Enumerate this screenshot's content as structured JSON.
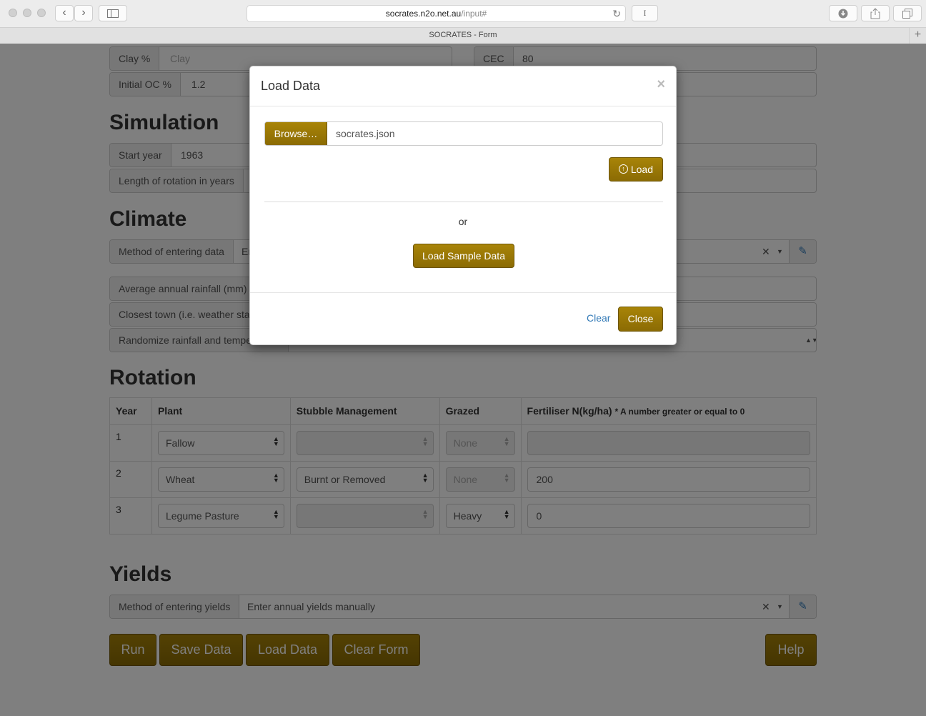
{
  "browser": {
    "url_host": "socrates.n2o.net.au",
    "url_path": "/input#",
    "tab_title": "SOCRATES - Form",
    "reader_label": "I"
  },
  "soil": {
    "clay_label": "Clay %",
    "clay_placeholder": "Clay",
    "cec_label": "CEC",
    "cec_value": "80",
    "oc_label": "Initial OC %",
    "oc_value": "1.2"
  },
  "simulation": {
    "heading": "Simulation",
    "start_label": "Start year",
    "start_value": "1963",
    "length_label": "Length of rotation in years"
  },
  "climate": {
    "heading": "Climate",
    "method_label": "Method of entering data",
    "method_value": "Er",
    "rain_label": "Average annual rainfall (mm)",
    "town_label": "Closest town (i.e. weather sta",
    "random_label": "Randomize rainfall and tempe"
  },
  "rotation": {
    "heading": "Rotation",
    "headers": {
      "year": "Year",
      "plant": "Plant",
      "stubble": "Stubble Management",
      "grazed": "Grazed",
      "fert": "Fertiliser N(kg/ha)",
      "fert_hint": "* A number greater or equal to 0"
    },
    "rows": [
      {
        "year": "1",
        "plant": "Fallow",
        "stubble": "",
        "grazed": "None",
        "fert": ""
      },
      {
        "year": "2",
        "plant": "Wheat",
        "stubble": "Burnt or Removed",
        "grazed": "None",
        "fert": "200"
      },
      {
        "year": "3",
        "plant": "Legume Pasture",
        "stubble": "",
        "grazed": "Heavy",
        "fert": "0"
      }
    ]
  },
  "yields": {
    "heading": "Yields",
    "method_label": "Method of entering yields",
    "method_value": "Enter annual yields manually"
  },
  "actions": {
    "run": "Run",
    "save": "Save Data",
    "load": "Load Data",
    "clear": "Clear Form",
    "help": "Help"
  },
  "modal": {
    "title": "Load Data",
    "close_x": "×",
    "browse": "Browse…",
    "filename": "socrates.json",
    "load": "Load",
    "or": "or",
    "sample": "Load Sample Data",
    "clear": "Clear",
    "close": "Close"
  }
}
